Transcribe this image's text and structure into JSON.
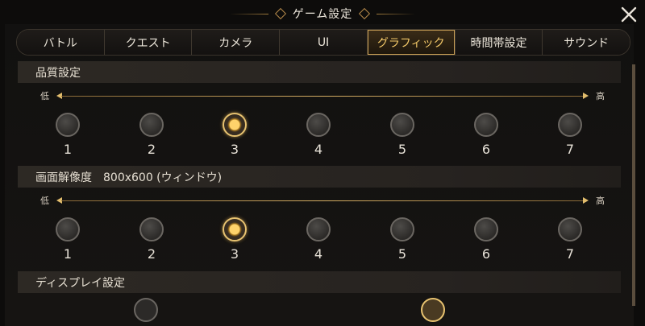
{
  "title": "ゲーム設定",
  "tabs": [
    {
      "label": "バトル",
      "active": false
    },
    {
      "label": "クエスト",
      "active": false
    },
    {
      "label": "カメラ",
      "active": false
    },
    {
      "label": "UI",
      "active": false
    },
    {
      "label": "グラフィック",
      "active": true
    },
    {
      "label": "時間帯設定",
      "active": false
    },
    {
      "label": "サウンド",
      "active": false
    }
  ],
  "quality": {
    "heading": "品質設定",
    "low": "低",
    "high": "高",
    "options": [
      "1",
      "2",
      "3",
      "4",
      "5",
      "6",
      "7"
    ],
    "selected": "3"
  },
  "resolution": {
    "heading": "画面解像度　800x600 (ウィンドウ)",
    "low": "低",
    "high": "高",
    "options": [
      "1",
      "2",
      "3",
      "4",
      "5",
      "6",
      "7"
    ],
    "selected": "3"
  },
  "display": {
    "heading": "ディスプレイ設定"
  },
  "colors": {
    "accent": "#f3c868",
    "active_tab_border": "#caa056"
  }
}
